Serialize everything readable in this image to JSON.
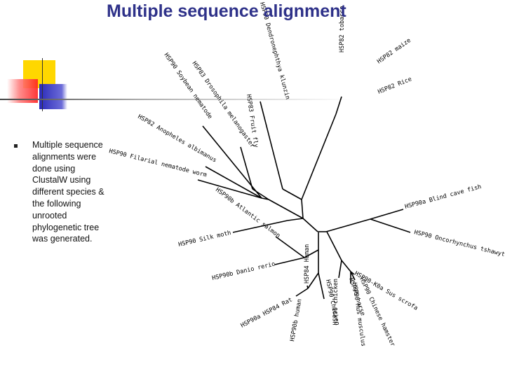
{
  "title": "Multiple sequence alignment",
  "bullet": "Multiple sequence alignments were done using ClustalW using different species & the following unrooted phylogenetic tree was generated.",
  "colors": {
    "title": "#2e3189",
    "yellow": "#ffd700",
    "red": "#ff3333",
    "blue": "#3333cc"
  },
  "tree": {
    "leaves": [
      "HSP82 tobacco",
      "HSP82 maize",
      "HSP82 Rice",
      "HSP90 Dendronephthya klunzin",
      "HSP83 Fruit fly",
      "HSP83 Drosophila melanogaster",
      "HSP90 Soybean nematode",
      "HSP82 Anopheles albimanus",
      "HSP90 Filarial nematode worm",
      "HSP90b Atlantic salmon",
      "HSP90 Silk moth",
      "HSP90b Danio rerio",
      "HSP84 Human",
      "HSP90a HSP84 Rat",
      "HSP90b human",
      "HSP90 Chicken",
      "HSP90 chicken",
      "HSP90-K0a Sus scrofa",
      "HSP90 horse",
      "HSP90 Mus musculus",
      "HSP90 Chinese hamster",
      "HSP90a Blind cave fish",
      "HSP90 Oncorhynchus tshawytscha"
    ]
  }
}
